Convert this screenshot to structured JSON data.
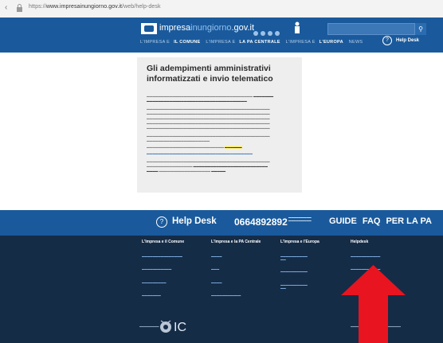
{
  "browser": {
    "url_prefix": "https://",
    "url_host": "www.impresainungiorno.gov.it",
    "url_path": "/web/help-desk"
  },
  "header": {
    "logo_text_main": "impresa",
    "logo_text_mid": "inungiorno",
    "logo_text_tld": ".gov.it",
    "nav": [
      {
        "label": "L'IMPRESA E",
        "strong": false
      },
      {
        "label": "IL COMUNE",
        "strong": true
      },
      {
        "label": "L'IMPRESA E",
        "strong": false
      },
      {
        "label": "LA PA CENTRALE",
        "strong": true
      },
      {
        "label": "L'IMPRESA E",
        "strong": false
      },
      {
        "label": "L'EUROPA",
        "strong": true
      },
      {
        "label": "NEWS",
        "strong": false
      }
    ],
    "help_label": "Help Desk"
  },
  "article": {
    "title": "Gli adempimenti amministrativi informatizzati e invio telematico"
  },
  "helpbar": {
    "label": "Help Desk",
    "phone": "0664892892",
    "links": [
      "GUIDE",
      "FAQ",
      "PER LA PA"
    ]
  },
  "footer": {
    "columns": [
      {
        "heading": "L'Impresa e il Comune"
      },
      {
        "heading": "L'Impresa e la PA Centrale"
      },
      {
        "heading": "L'Impresa e l'Europa"
      },
      {
        "heading": "Helpdesk"
      }
    ],
    "logo_text": "IC"
  },
  "colors": {
    "header_blue": "#1a5a9c",
    "footer_navy": "#152c47",
    "highlight_yellow": "#fff27a",
    "arrow_red": "#e8141f"
  }
}
